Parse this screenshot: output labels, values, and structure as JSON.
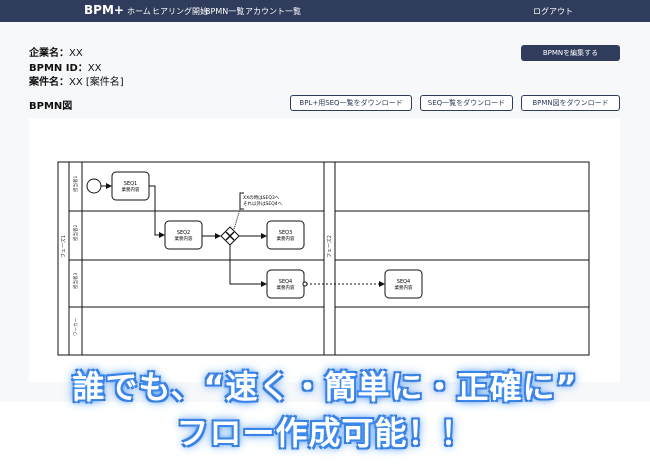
{
  "nav": {
    "brand": "BPM+",
    "items": [
      "ホーム",
      "ヒアリング開始",
      "BPMN一覧",
      "アカウント一覧"
    ],
    "logout": "ログアウト"
  },
  "meta": {
    "company_label": "企業名：",
    "company_value": "XX",
    "bpmn_id_label": "BPMN ID：",
    "bpmn_id_value": "XX",
    "case_label": "案件名：",
    "case_value": "XX [案件名]"
  },
  "buttons": {
    "edit": "BPMNを編集する",
    "download_bpl": "BPL+用SEQ一覧をダウンロード",
    "download_seq": "SEQ一覧をダウンロード",
    "download_bpmn": "BPMN図をダウンロード"
  },
  "section": {
    "title": "BPMN図"
  },
  "diagram": {
    "phase1": "フェーズ1",
    "phase2": "フェーズ2",
    "lanes": [
      "担当者1",
      "担当者2",
      "担当者3",
      "ワーカー"
    ],
    "tasks": [
      {
        "id": "SEQ1",
        "desc": "業務内容"
      },
      {
        "id": "SEQ2",
        "desc": "業務内容"
      },
      {
        "id": "SEQ3",
        "desc": "業務内容"
      },
      {
        "id": "SEQ4",
        "desc": "業務内容"
      },
      {
        "id": "SEQ4",
        "desc": "業務内容"
      }
    ],
    "annotation_1": "XXの時はSEQ3へ",
    "annotation_2": "それ以外はSEQ4へ"
  },
  "banner": {
    "line1": "誰でも、“速く・簡単に・正確に”",
    "line2": "フロー作成可能！！"
  },
  "colors": {
    "nav": "#2f3c5c",
    "accent": "#3e8df0"
  }
}
